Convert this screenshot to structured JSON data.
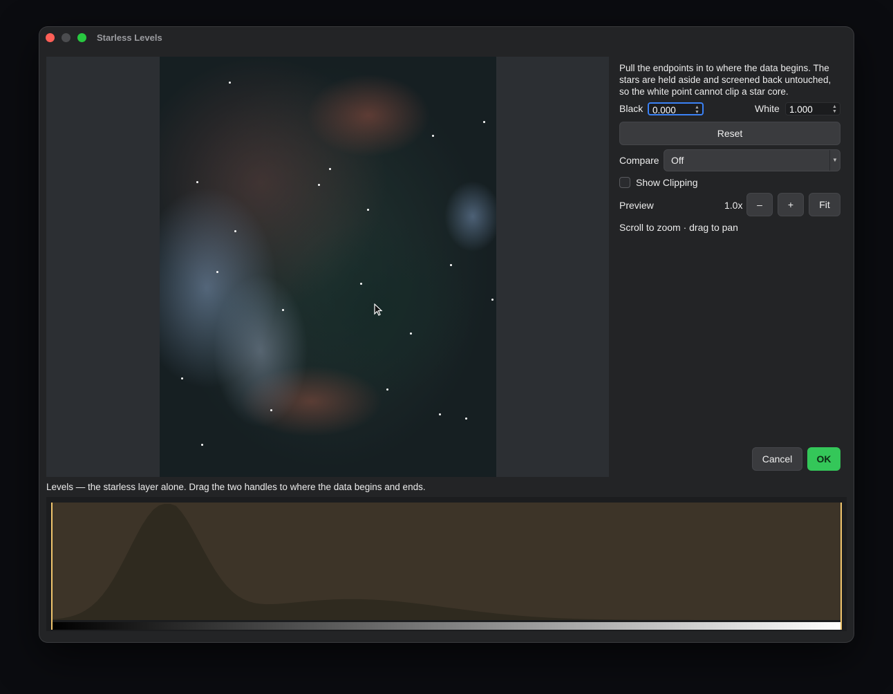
{
  "window": {
    "title": "Starless Levels"
  },
  "side_panel": {
    "description": "Pull the endpoints in to where the data begins. The stars are held aside and screened back untouched, so the white point cannot clip a star core.",
    "black": {
      "label": "Black",
      "value": "0.000"
    },
    "white": {
      "label": "White",
      "value": "1.000"
    },
    "reset_label": "Reset",
    "compare": {
      "label": "Compare",
      "value": "Off"
    },
    "show_clipping": {
      "label": "Show Clipping",
      "checked": false
    },
    "preview": {
      "label": "Preview",
      "zoom": "1.0x",
      "zoom_out": "–",
      "zoom_in": "+",
      "fit": "Fit"
    },
    "hint": "Scroll to zoom · drag to pan",
    "cancel_label": "Cancel",
    "ok_label": "OK"
  },
  "levels": {
    "caption": "Levels — the starless layer alone. Drag the two handles to where the data begins and ends.",
    "black_point": 0.0,
    "white_point": 1.0
  },
  "colors": {
    "ok": "#34c759",
    "histogram_fill": "#3d3428",
    "histogram_peak": "#2f2a1f",
    "handle": "#f2c66d"
  }
}
